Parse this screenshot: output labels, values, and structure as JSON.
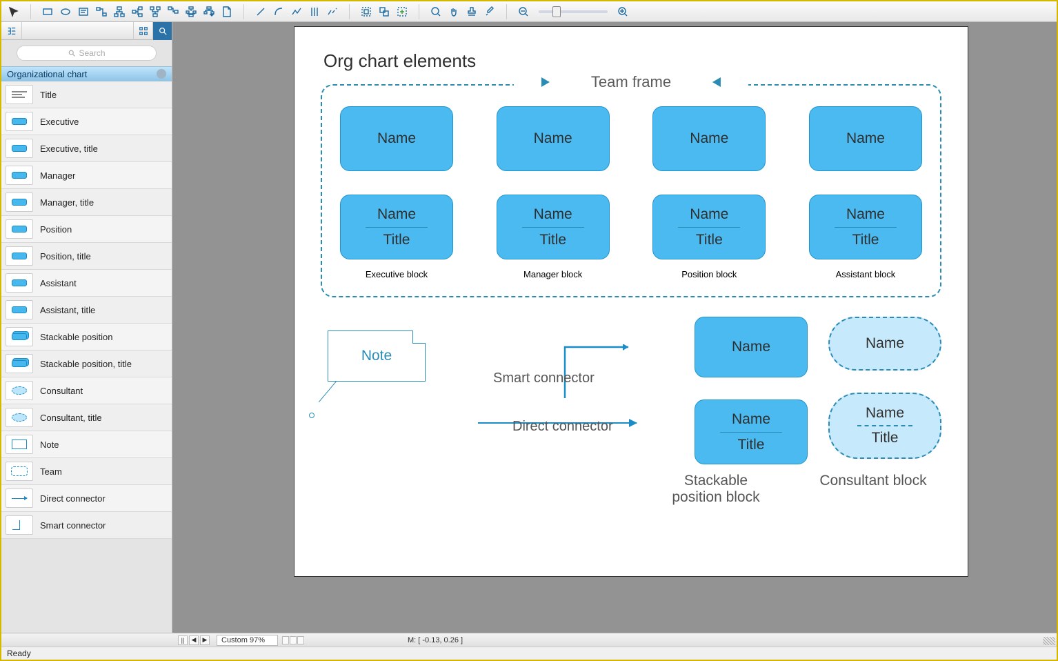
{
  "toolbar": {
    "groups": [
      [
        "cursor",
        "rect",
        "ellipse",
        "textbox",
        "connector-tool",
        "node1",
        "node2",
        "node3",
        "branch",
        "tree",
        "tree-dd",
        "page"
      ],
      [
        "line",
        "curve",
        "polyline",
        "double-line",
        "broken"
      ],
      [
        "group",
        "ungroup",
        "regroup"
      ],
      [
        "zoom-fit",
        "pan",
        "highlight",
        "eyedropper"
      ],
      [
        "zoom-out",
        "zoom-slider",
        "zoom-in"
      ]
    ]
  },
  "sidebar": {
    "search_placeholder": "Search",
    "library_title": "Organizational chart",
    "items": [
      {
        "label": "Title",
        "thumb": "title"
      },
      {
        "label": "Executive",
        "thumb": "sq"
      },
      {
        "label": "Executive, title",
        "thumb": "sq"
      },
      {
        "label": "Manager",
        "thumb": "sq"
      },
      {
        "label": "Manager, title",
        "thumb": "sq"
      },
      {
        "label": "Position",
        "thumb": "sq"
      },
      {
        "label": "Position, title",
        "thumb": "sq"
      },
      {
        "label": "Assistant",
        "thumb": "sq"
      },
      {
        "label": "Assistant, title",
        "thumb": "sq"
      },
      {
        "label": "Stackable position",
        "thumb": "stack"
      },
      {
        "label": "Stackable position, title",
        "thumb": "stack"
      },
      {
        "label": "Consultant",
        "thumb": "ov"
      },
      {
        "label": "Consultant, title",
        "thumb": "ov"
      },
      {
        "label": "Note",
        "thumb": "note"
      },
      {
        "label": "Team",
        "thumb": "team"
      },
      {
        "label": "Direct connector",
        "thumb": "arrow"
      },
      {
        "label": "Smart connector",
        "thumb": "elbow"
      }
    ]
  },
  "canvas": {
    "title": "Org chart elements",
    "team_frame_label": "Team frame",
    "name_text": "Name",
    "title_text": "Title",
    "col_labels": [
      "Executive block",
      "Manager block",
      "Position block",
      "Assistant block"
    ],
    "note_text": "Note",
    "smart_connector_label": "Smart connector",
    "direct_connector_label": "Direct connector",
    "lower_labels": [
      "Stackable position block",
      "Consultant block"
    ]
  },
  "status": {
    "zoom": "Custom 97%",
    "coords": "M: [ -0.13, 0.26 ]",
    "ready": "Ready"
  }
}
